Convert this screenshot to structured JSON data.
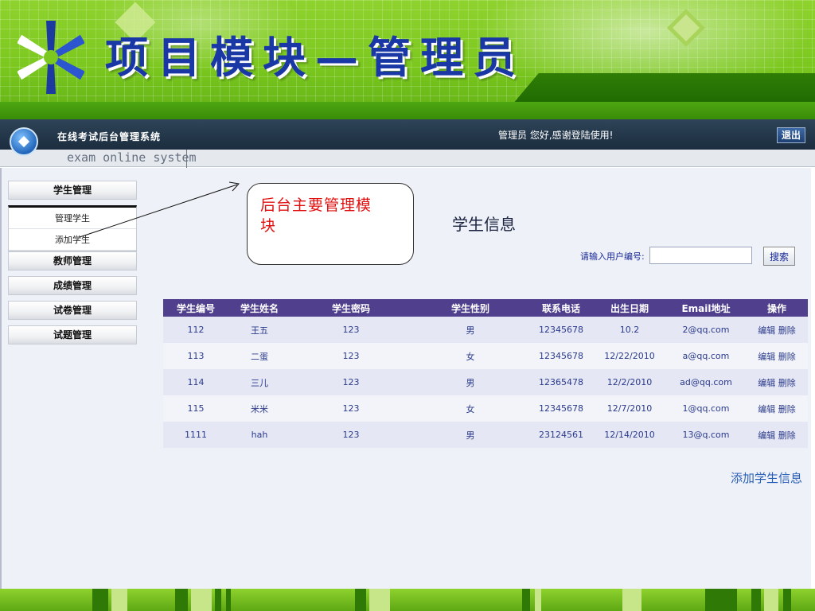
{
  "banner": {
    "title": "项目模块—管理员"
  },
  "header": {
    "system_name": "在线考试后台管理系统",
    "system_name_en": "exam online system",
    "welcome": "管理员 您好,感谢登陆使用!",
    "logout_label": "退出"
  },
  "sidebar": {
    "groups": [
      {
        "label": "学生管理",
        "items": [
          {
            "label": "管理学生"
          },
          {
            "label": "添加学生"
          }
        ]
      },
      {
        "label": "教师管理"
      },
      {
        "label": "成绩管理"
      },
      {
        "label": "试卷管理"
      },
      {
        "label": "试题管理"
      }
    ]
  },
  "callout": {
    "line1": "后台主要管理模",
    "line2": "块"
  },
  "main": {
    "title": "学生信息",
    "search_label": "请输入用户编号:",
    "search_value": "",
    "search_button": "搜索",
    "add_link": "添加学生信息"
  },
  "table": {
    "columns": [
      "学生编号",
      "学生姓名",
      "学生密码",
      "学生性别",
      "联系电话",
      "出生日期",
      "Email地址",
      "操作"
    ],
    "rows": [
      {
        "id": "112",
        "name": "王五",
        "password": "123",
        "gender": "男",
        "phone": "12345678",
        "birth": "10.2",
        "email": "2@qq.com"
      },
      {
        "id": "113",
        "name": "二蛋",
        "password": "123",
        "gender": "女",
        "phone": "12345678",
        "birth": "12/22/2010",
        "email": "a@qq.com"
      },
      {
        "id": "114",
        "name": "三儿",
        "password": "123",
        "gender": "男",
        "phone": "12365478",
        "birth": "12/2/2010",
        "email": "ad@qq.com"
      },
      {
        "id": "115",
        "name": "米米",
        "password": "123",
        "gender": "女",
        "phone": "12345678",
        "birth": "12/7/2010",
        "email": "1@qq.com"
      },
      {
        "id": "1111",
        "name": "hah",
        "password": "123",
        "gender": "男",
        "phone": "23124561",
        "birth": "12/14/2010",
        "email": "13@q.com"
      }
    ],
    "edit_label": "编辑",
    "delete_label": "删除"
  },
  "colors": {
    "header_row": "#4f3f8c",
    "banner_green": "#7cc81f",
    "title_blue": "#1a37a6",
    "callout_red": "#e01010"
  }
}
